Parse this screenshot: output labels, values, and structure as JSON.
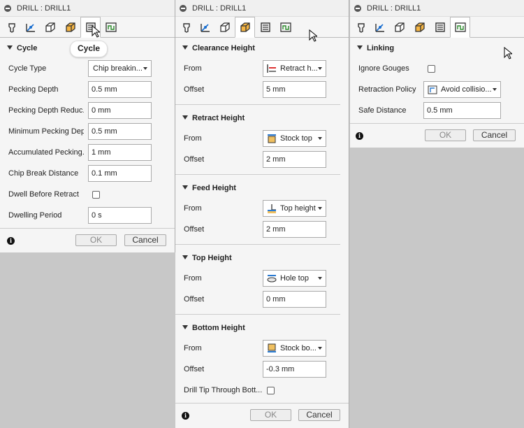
{
  "panels": [
    {
      "title": "DRILL : DRILL1",
      "active_tab": 4,
      "section": "Cycle",
      "tooltip": "Cycle",
      "fields": {
        "cycle_type_label": "Cycle Type",
        "cycle_type_value": "Chip breakin...",
        "pecking_depth_label": "Pecking Depth",
        "pecking_depth_value": "0.5 mm",
        "pecking_reduc_label": "Pecking Depth Reduc...",
        "pecking_reduc_value": "0 mm",
        "min_pecking_label": "Minimum Pecking Dep...",
        "min_pecking_value": "0.5 mm",
        "accum_pecking_label": "Accumulated Pecking...",
        "accum_pecking_value": "1 mm",
        "chip_break_label": "Chip Break Distance",
        "chip_break_value": "0.1 mm",
        "dwell_label": "Dwell Before Retract",
        "dwell_checked": false,
        "dwelling_period_label": "Dwelling Period",
        "dwelling_period_value": "0 s"
      },
      "ok": "OK",
      "cancel": "Cancel"
    },
    {
      "title": "DRILL : DRILL1",
      "active_tab": 3,
      "sections": {
        "clearance": {
          "title": "Clearance Height",
          "from_label": "From",
          "from_value": "Retract h...",
          "offset_label": "Offset",
          "offset_value": "5 mm"
        },
        "retract": {
          "title": "Retract Height",
          "from_label": "From",
          "from_value": "Stock top",
          "offset_label": "Offset",
          "offset_value": "2 mm"
        },
        "feed": {
          "title": "Feed Height",
          "from_label": "From",
          "from_value": "Top height",
          "offset_label": "Offset",
          "offset_value": "2 mm"
        },
        "top": {
          "title": "Top Height",
          "from_label": "From",
          "from_value": "Hole top",
          "offset_label": "Offset",
          "offset_value": "0 mm"
        },
        "bottom": {
          "title": "Bottom Height",
          "from_label": "From",
          "from_value": "Stock bo...",
          "offset_label": "Offset",
          "offset_value": "-0.3 mm",
          "drill_tip_label": "Drill Tip Through Bott...",
          "drill_tip_checked": false
        }
      },
      "ok": "OK",
      "cancel": "Cancel"
    },
    {
      "title": "DRILL : DRILL1",
      "active_tab": 5,
      "section": "Linking",
      "fields": {
        "ignore_gouges_label": "Ignore Gouges",
        "ignore_gouges_checked": false,
        "retraction_policy_label": "Retraction Policy",
        "retraction_policy_value": "Avoid collisio...",
        "safe_distance_label": "Safe Distance",
        "safe_distance_value": "0.5 mm"
      },
      "ok": "OK",
      "cancel": "Cancel"
    }
  ],
  "tab_icons": [
    "tool-tab-icon",
    "geometry-tab-icon",
    "heights-tab-icon",
    "passes-tab-icon",
    "cycle-tab-icon",
    "linking-tab-icon"
  ],
  "colors": {
    "active_tab_bg": "#ffffff",
    "panel_bg": "#f5f5f5",
    "desktop_bg": "#c8c8c8"
  }
}
